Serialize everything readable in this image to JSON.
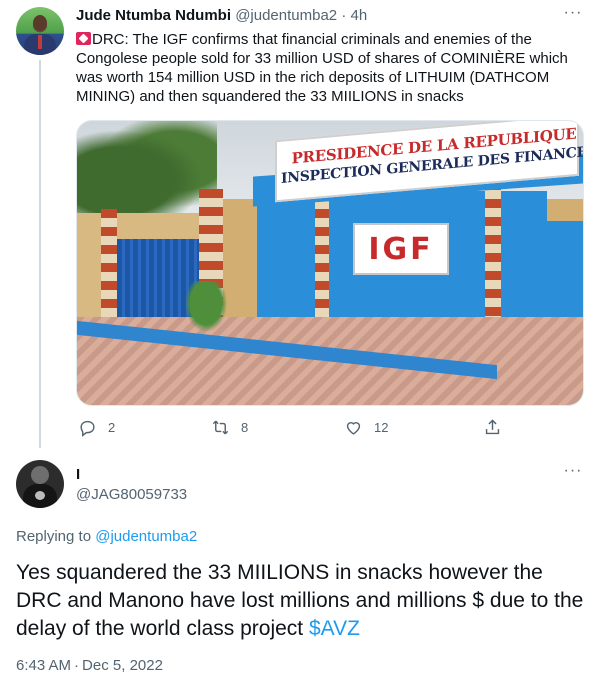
{
  "tweet1": {
    "author_name": "Jude Ntumba Ndumbi",
    "author_handle": "@judentumba2",
    "separator": "·",
    "time": "4h",
    "more_label": "···",
    "flag_icon": "red-exclamation-flag-icon",
    "text": "DRC: The IGF confirms that financial criminals and enemies of the Congolese people sold for 33 million USD of shares of COMINIÈRE which was worth 154 million USD in the rich deposits of LITHUIM (DATHCOM MINING) and then squandered the 33 MIILIONS in snacks",
    "image": {
      "sign_line1": "PRESIDENCE DE LA REPUBLIQUE",
      "sign_line2": "INSPECTION GENERALE DES FINANCES",
      "plate": "IGF"
    },
    "actions": {
      "reply_count": "2",
      "retweet_count": "8",
      "like_count": "12"
    }
  },
  "tweet2": {
    "author_name": "I",
    "author_handle": "@JAG80059733",
    "more_label": "···",
    "replying_prefix": "Replying to",
    "replying_to": "@judentumba2",
    "text_main": "Yes squandered the 33 MIILIONS in snacks however the DRC and Manono have lost millions and millions $ due to the delay of the world class project",
    "cashtag": "$AVZ",
    "time": "6:43 AM",
    "date_sep": "·",
    "date": "Dec 5, 2022"
  },
  "colors": {
    "accent": "#1d9bf0",
    "muted": "#536471",
    "text": "#0f1419",
    "thread_line": "#cfd9de"
  }
}
